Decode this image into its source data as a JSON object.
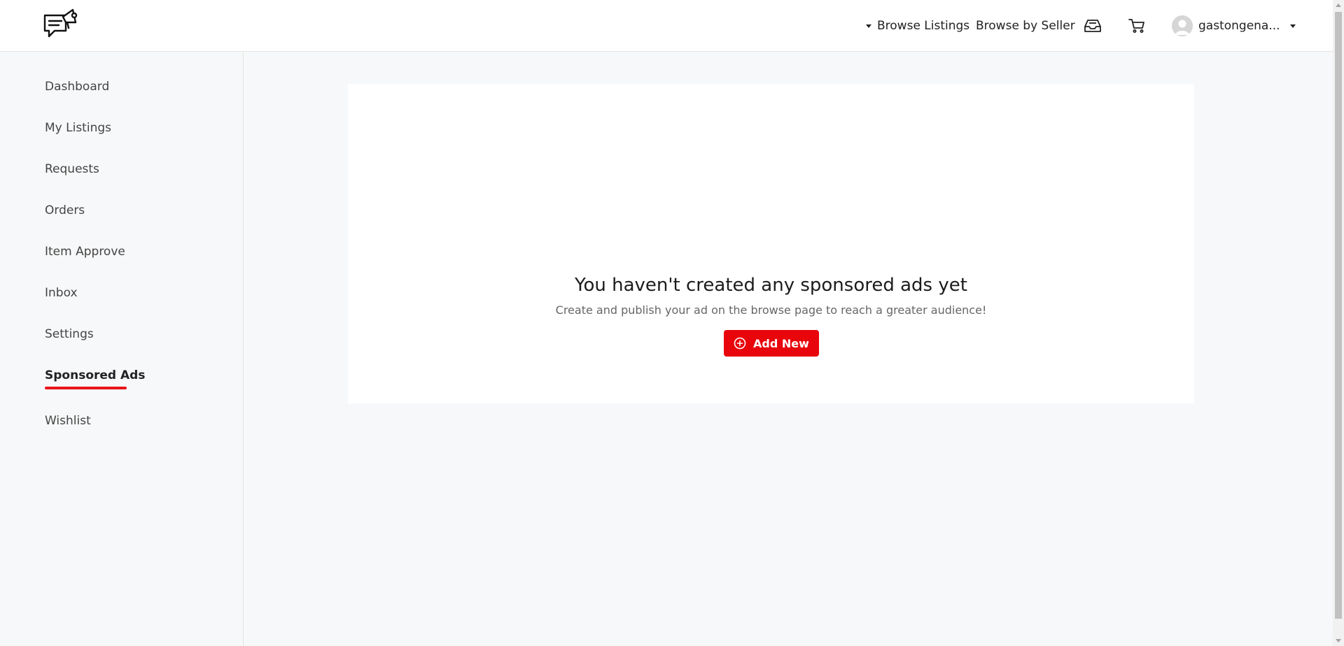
{
  "header": {
    "logo_icon": "megaphone-chat-logo-icon",
    "browse_listings_label": "Browse Listings",
    "browse_by_seller_label": "Browse by Seller",
    "inbox_icon": "inbox-tray-icon",
    "cart_icon": "shopping-cart-icon",
    "user_name": "gastongena...",
    "avatar_icon": "user-avatar-icon"
  },
  "sidebar": {
    "items": [
      {
        "label": "Dashboard"
      },
      {
        "label": "My Listings"
      },
      {
        "label": "Requests"
      },
      {
        "label": "Orders"
      },
      {
        "label": "Item Approve"
      },
      {
        "label": "Inbox"
      },
      {
        "label": "Settings"
      },
      {
        "label": "Sponsored Ads",
        "active": true
      },
      {
        "label": "Wishlist"
      }
    ]
  },
  "main": {
    "empty_title": "You haven't created any sponsored ads yet",
    "empty_subtitle": "Create and publish your ad on the browse page to reach a greater audience!",
    "add_button_label": "Add New",
    "add_button_icon": "plus-circle-icon"
  },
  "colors": {
    "accent": "#e8060c",
    "background": "#f7f8f9",
    "card": "#ffffff"
  }
}
